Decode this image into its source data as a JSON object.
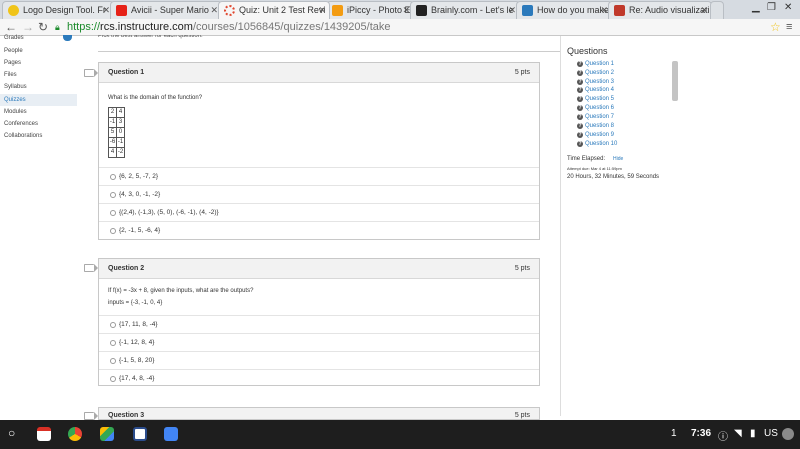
{
  "tabs": [
    {
      "title": "Logo Design Tool. Fr",
      "color": "#f0c419"
    },
    {
      "title": "Avicii - Super Mario",
      "color": "#e62117"
    },
    {
      "title": "Quiz: Unit 2 Test Revi",
      "color": "#e0462e"
    },
    {
      "title": "iPiccy - Photo Editor",
      "color": "#f39c12"
    },
    {
      "title": "Brainly.com - Let's le",
      "color": "#222222"
    },
    {
      "title": "How do you make a",
      "color": "#2b7abc"
    },
    {
      "title": "Re: Audio visualizati",
      "color": "#c0392b"
    }
  ],
  "toolbar": {
    "url_secure": "https://",
    "url_host": "rcs.instructure.com",
    "url_path": "/courses/1056845/quizzes/1439205/take"
  },
  "nav": {
    "items": [
      "Grades",
      "People",
      "Pages",
      "Files",
      "Syllabus",
      "Quizzes",
      "Modules",
      "Conferences",
      "Collaborations"
    ]
  },
  "instructions": "Pick the best answer for each question.",
  "questions": [
    {
      "title": "Question 1",
      "points": "5 pts",
      "text": "What is the domain of the function?",
      "table": [
        [
          "2",
          "4"
        ],
        [
          "-1",
          "3"
        ],
        [
          "5",
          "0"
        ],
        [
          "-6",
          "-1"
        ],
        [
          "4",
          "-2"
        ]
      ],
      "answers": [
        "{6, 2, 5, -7, 2}",
        "{4, 3, 0, -1, -2}",
        "{(2,4), (-1,3), (5, 0), (-6, -1), (4, -2)}",
        "{2, -1, 5, -6, 4}"
      ]
    },
    {
      "title": "Question 2",
      "points": "5 pts",
      "text": "If f(x) = -3x + 8, given the inputs, what are the outputs?",
      "subtext": "inputs = {-3, -1, 0, 4}",
      "answers": [
        "{17, 11, 8, -4}",
        "{-1, 12, 8, 4}",
        "{-1, 5, 8, 20}",
        "{17, 4, 8, -4}"
      ]
    },
    {
      "title": "Question 3",
      "points": "5 pts"
    }
  ],
  "sidebar": {
    "title": "Questions",
    "items": [
      "Question 1",
      "Question 2",
      "Question 3",
      "Question 4",
      "Question 5",
      "Question 6",
      "Question 7",
      "Question 8",
      "Question 9",
      "Question 10"
    ],
    "elapsed_label": "Time Elapsed:",
    "hide_label": "Hide",
    "due": "Attempt due: Mar 4 at 11:59pm",
    "elapsed": "20 Hours, 32 Minutes, 59 Seconds"
  },
  "taskbar": {
    "badge": "1",
    "time": "7:36",
    "locale": "US"
  }
}
